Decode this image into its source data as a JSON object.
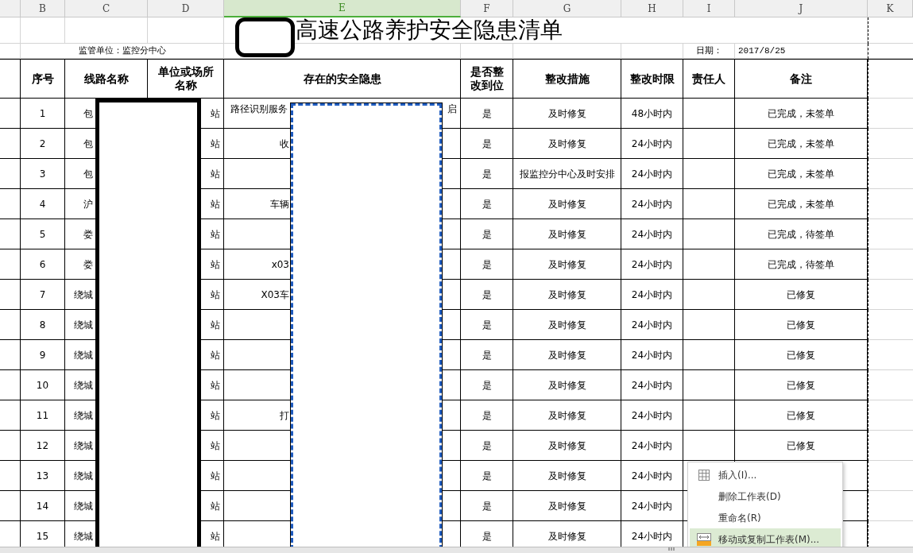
{
  "columns": [
    {
      "selected": false
    },
    {
      "label": "B",
      "selected": false
    },
    {
      "label": "C",
      "selected": false
    },
    {
      "label": "D",
      "selected": false
    },
    {
      "label": "E",
      "selected": true
    },
    {
      "label": "F",
      "selected": false
    },
    {
      "label": "G",
      "selected": false
    },
    {
      "label": "H",
      "selected": false
    },
    {
      "label": "I",
      "selected": false
    },
    {
      "label": "J",
      "selected": false
    },
    {
      "label": "K",
      "selected": false
    }
  ],
  "title": "高速公路养护安全隐患清单",
  "supervisor": "监管单位：监控分中心",
  "date_label": "日期：",
  "date_value": "2017/8/25",
  "headers": [
    "序号",
    "线路名称",
    "单位或场所名称",
    "存在的安全隐患",
    "是否整改到位",
    "整改措施",
    "整改时限",
    "责任人",
    "备注"
  ],
  "rows": [
    {
      "no": "1",
      "route": "包",
      "unit": "站",
      "hazard": "路径识别服务",
      "hazard_end": "启",
      "fixed": "是",
      "measure": "及时修复",
      "deadline": "48小时内",
      "remark": "已完成，未签单"
    },
    {
      "no": "2",
      "route": "包",
      "unit": "站",
      "hazard": "收",
      "fixed": "是",
      "measure": "及时修复",
      "deadline": "24小时内",
      "remark": "已完成，未签单"
    },
    {
      "no": "3",
      "route": "包",
      "unit": "站",
      "fixed": "是",
      "measure": "报监控分中心及时安排",
      "deadline": "24小时内",
      "remark": "已完成，未签单"
    },
    {
      "no": "4",
      "route": "沪",
      "unit": "站",
      "hazard": "车辆",
      "fixed": "是",
      "measure": "及时修复",
      "deadline": "24小时内",
      "remark": "已完成，未签单"
    },
    {
      "no": "5",
      "route": "娄",
      "unit": "站",
      "fixed": "是",
      "measure": "及时修复",
      "deadline": "24小时内",
      "remark": "已完成，待签单"
    },
    {
      "no": "6",
      "route": "娄",
      "unit": "站",
      "hazard": "x03",
      "fixed": "是",
      "measure": "及时修复",
      "deadline": "24小时内",
      "remark": "已完成，待签单"
    },
    {
      "no": "7",
      "route": "绕城",
      "unit": "站",
      "hazard": "X03车",
      "fixed": "是",
      "measure": "及时修复",
      "deadline": "24小时内",
      "remark": "已修复"
    },
    {
      "no": "8",
      "route": "绕城",
      "unit": "站",
      "fixed": "是",
      "measure": "及时修复",
      "deadline": "24小时内",
      "remark": "已修复"
    },
    {
      "no": "9",
      "route": "绕城",
      "unit": "站",
      "fixed": "是",
      "measure": "及时修复",
      "deadline": "24小时内",
      "remark": "已修复"
    },
    {
      "no": "10",
      "route": "绕城",
      "unit": "站",
      "fixed": "是",
      "measure": "及时修复",
      "deadline": "24小时内",
      "remark": "已修复"
    },
    {
      "no": "11",
      "route": "绕城",
      "unit": "站",
      "hazard": "打",
      "fixed": "是",
      "measure": "及时修复",
      "deadline": "24小时内",
      "remark": "已修复"
    },
    {
      "no": "12",
      "route": "绕城",
      "unit": "站",
      "fixed": "是",
      "measure": "及时修复",
      "deadline": "24小时内",
      "remark": "已修复"
    },
    {
      "no": "13",
      "route": "绕城",
      "unit": "站",
      "fixed": "是",
      "measure": "及时修复",
      "deadline": "24小时内"
    },
    {
      "no": "14",
      "route": "绕城",
      "unit": "站",
      "fixed": "是",
      "measure": "及时修复",
      "deadline": "24小时内"
    },
    {
      "no": "15",
      "route": "绕城",
      "unit": "站",
      "fixed": "是",
      "measure": "及时修复",
      "deadline": "24小时内"
    }
  ],
  "context_menu": [
    {
      "label": "插入(I)...",
      "selected": false
    },
    {
      "label": "删除工作表(D)",
      "selected": false
    },
    {
      "label": "重命名(R)",
      "selected": false
    },
    {
      "label": "移动或复制工作表(M)...",
      "selected": true
    }
  ]
}
